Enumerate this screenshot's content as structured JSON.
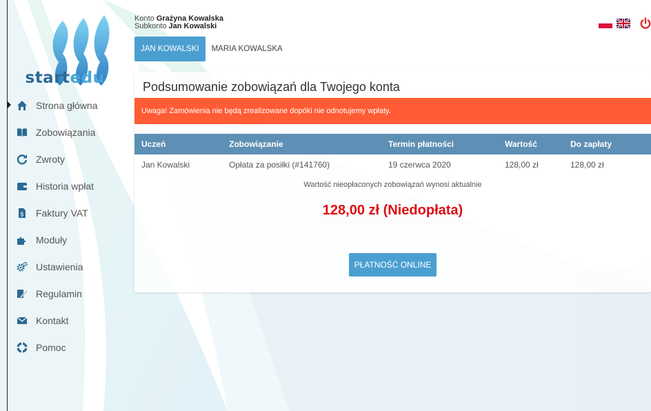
{
  "account": {
    "konto_label": "Konto",
    "konto_name": "Grażyna Kowalska",
    "subkonto_label": "Subkonto",
    "subkonto_name": "Jan Kowalski"
  },
  "tabs": [
    {
      "label": "JAN KOWALSKI",
      "active": true
    },
    {
      "label": "MARIA KOWALSKA",
      "active": false
    }
  ],
  "logo": {
    "text_a": "start",
    "text_b": "edu"
  },
  "sidebar": {
    "items": [
      {
        "label": "Strona główna",
        "icon": "home-icon",
        "active": true
      },
      {
        "label": "Zobowiązania",
        "icon": "book-icon"
      },
      {
        "label": "Zwroty",
        "icon": "refresh-icon"
      },
      {
        "label": "Historia wpłat",
        "icon": "wallet-icon"
      },
      {
        "label": "Faktury VAT",
        "icon": "invoice-icon"
      },
      {
        "label": "Moduły",
        "icon": "puzzle-icon"
      },
      {
        "label": "Ustawienia",
        "icon": "gears-icon"
      },
      {
        "label": "Regulamin",
        "icon": "edit-document-icon"
      },
      {
        "label": "Kontakt",
        "icon": "envelope-icon"
      },
      {
        "label": "Pomoc",
        "icon": "lifebuoy-icon"
      }
    ]
  },
  "header_icons": {
    "flag_pl": "poland-flag-icon",
    "flag_uk": "uk-flag-icon",
    "power": "power-icon"
  },
  "panel": {
    "title": "Podsumowanie zobowiązań dla Twojego konta",
    "alert": "Uwaga! Zamówienia nie będą zrealizowane dopóki nie odnotujemy wpłaty.",
    "columns": [
      "Uczeń",
      "Zobowiązanie",
      "Termin płatności",
      "Wartość",
      "Do zapłaty"
    ],
    "rows": [
      [
        "Jan Kowalski",
        "Opłata za posiłki (#141760)",
        "19 czerwca 2020",
        "128,00 zł",
        "128,00 zł"
      ]
    ],
    "summary_text": "Wartość nieopłaconych zobowiązań wynosi aktualnie",
    "summary_amount": "128,00 zł (Niedopłata)",
    "pay_button": "PŁATNOŚĆ ONLINE"
  },
  "colors": {
    "accent": "#4b9fd0",
    "alert": "#ff5c35",
    "table_header": "#5e8fb4",
    "amount": "#e00d14",
    "power": "#e32a2a"
  }
}
